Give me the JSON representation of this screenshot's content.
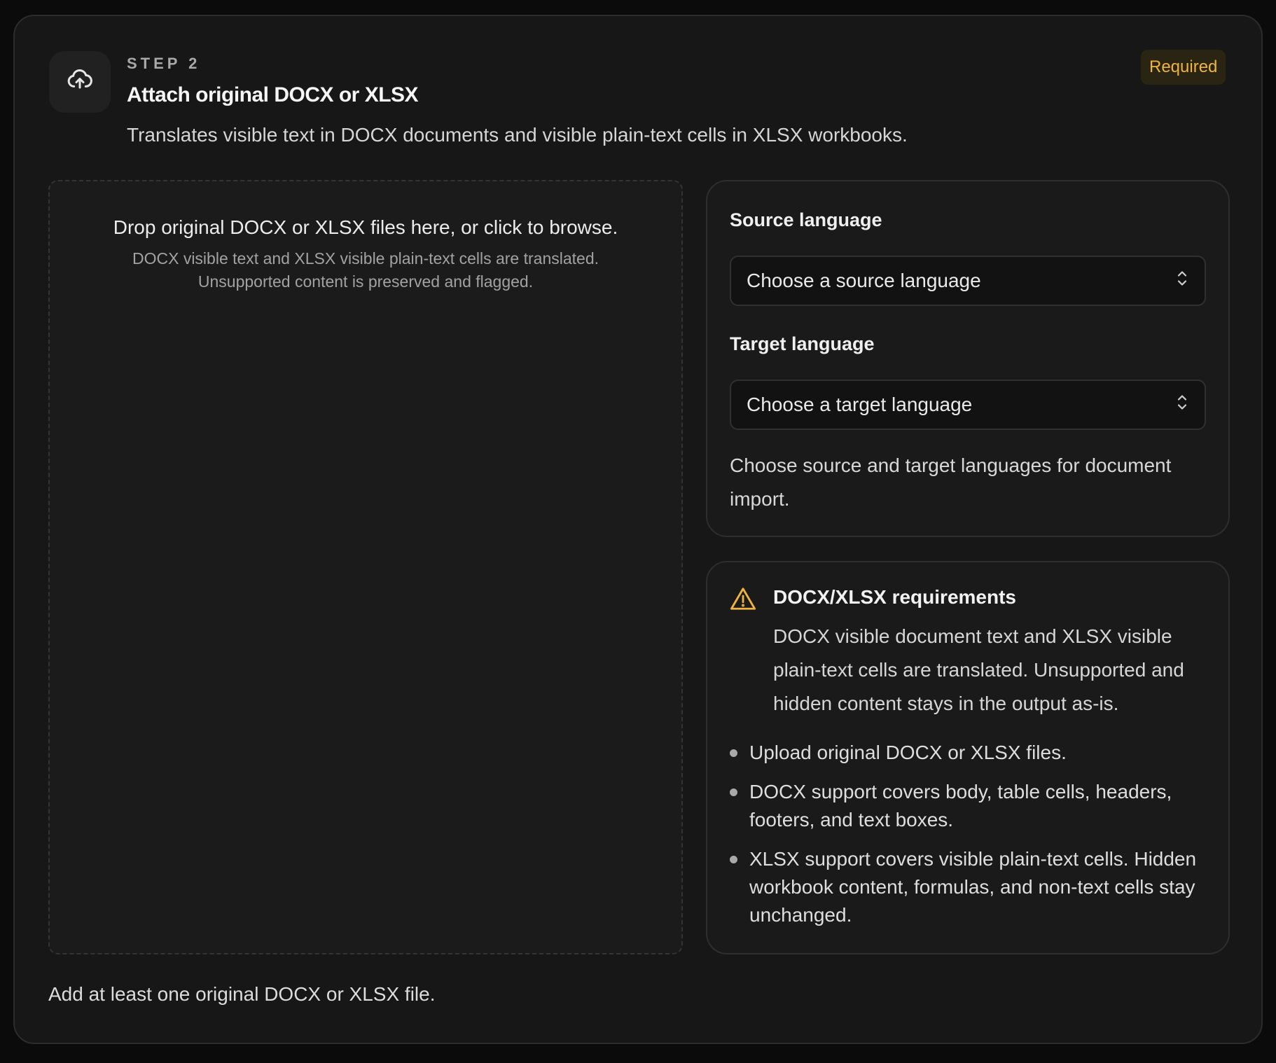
{
  "step": {
    "label": "STEP 2",
    "icon": "cloud-upload-icon",
    "title": "Attach original DOCX or XLSX",
    "description": "Translates visible text in DOCX documents and visible plain-text cells in XLSX workbooks.",
    "badge": "Required"
  },
  "dropzone": {
    "main": "Drop original DOCX or XLSX files here, or click to browse.",
    "sub_line1": "DOCX visible text and XLSX visible plain-text cells are translated.",
    "sub_line2": "Unsupported content is preserved and flagged."
  },
  "languages": {
    "source_label": "Source language",
    "source_value": "Choose a source language",
    "target_label": "Target language",
    "target_value": "Choose a target language",
    "help": "Choose source and target languages for document import."
  },
  "requirements": {
    "icon": "warning-icon",
    "title": "DOCX/XLSX requirements",
    "description": "DOCX visible document text and XLSX visible plain-text cells are translated. Unsupported and hidden content stays in the output as-is.",
    "items": [
      "Upload original DOCX or XLSX files.",
      "DOCX support covers body, table cells, headers, footers, and text boxes.",
      "XLSX support covers visible plain-text cells. Hidden workbook content, formulas, and non-text cells stay unchanged."
    ]
  },
  "footer": {
    "note": "Add at least one original DOCX or XLSX file."
  },
  "colors": {
    "card_bg": "#171717",
    "badge_text": "#f0b43c",
    "badge_bg": "#2a2412",
    "warning": "#f0b43c"
  }
}
